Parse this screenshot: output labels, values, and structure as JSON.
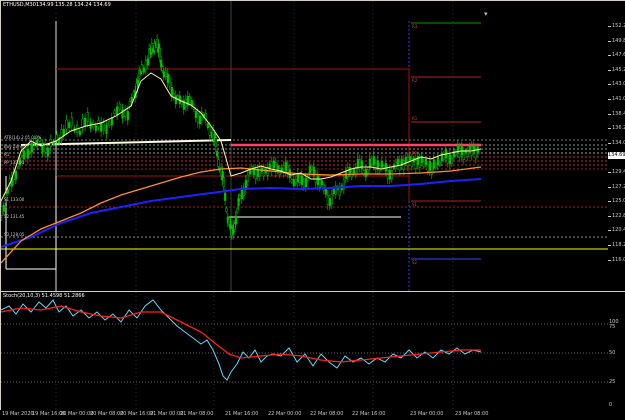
{
  "window": {
    "title": "ETHUSD,M30",
    "ohlc": "134.99 135.28 134.24 134.69",
    "close_symbol": "▾"
  },
  "price_axis": {
    "labels": [
      "152.25",
      "149.85",
      "147.65",
      "145.25",
      "143.05",
      "141.00",
      "138.45",
      "136.25",
      "134.05",
      "131.85",
      "129.45",
      "127.25",
      "125.00",
      "122.85",
      "120.45",
      "118.25",
      "116.05"
    ],
    "current_price": "134.69"
  },
  "levels": {
    "tags": [
      "R3",
      "R2",
      "R1",
      "PP",
      "S1",
      "S2"
    ]
  },
  "left_labels": [
    "ATR(14) 2.05 0.0%",
    "Buy Zone",
    "R1",
    "PP  135.00",
    "S1  133.00",
    "S2 131.45",
    "S3  128.05"
  ],
  "stoch": {
    "title": "Stoch(20,10,3) 51.4598 51.2866",
    "labels": [
      "100",
      "75",
      "50",
      "25",
      "0"
    ]
  },
  "time_axis": {
    "labels": [
      "19 Mar 2020",
      "19 Mar 16:00",
      "20 Mar 00:00",
      "20 Mar 08:00",
      "20 Mar 16:00",
      "21 Mar 00:00",
      "21 Mar 08:00",
      "21 Mar 16:00",
      "22 Mar 00:00",
      "22 Mar 08:00",
      "22 Mar 16:00",
      "23 Mar 00:00",
      "23 Mar 08:00"
    ]
  },
  "colors": {
    "background": "#000000",
    "up_candle": "#00c000",
    "down_candle": "#00c000",
    "ma_fast": "#fffacd",
    "ma_mid": "#ff8c00",
    "ma_slow": "#0000ff",
    "pivot_line": "#ff4040",
    "resistance": "#b22222",
    "stoch_main": "#5fd7ff",
    "stoch_signal": "#ff0000",
    "yellow_line": "#ffff00"
  }
}
